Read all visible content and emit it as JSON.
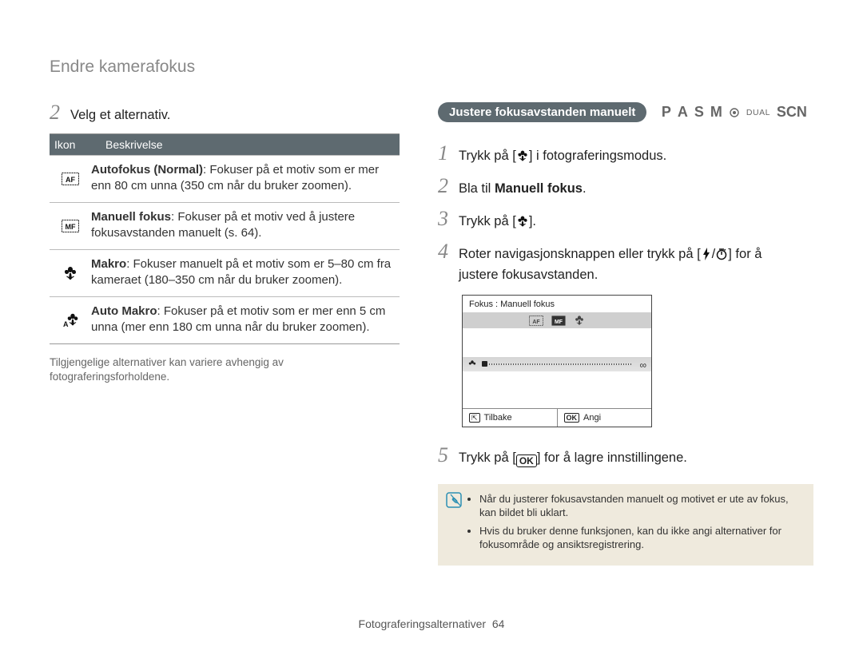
{
  "page": {
    "title": "Endre kamerafokus",
    "footer_label": "Fotograferingsalternativer",
    "footer_page": "64"
  },
  "left": {
    "step2_num": "2",
    "step2_txt": "Velg et alternativ.",
    "table": {
      "h_icon": "Ikon",
      "h_desc": "Beskrivelse",
      "rows": [
        {
          "icon_name": "af-icon",
          "desc_bold": "Autofokus (Normal)",
          "desc_rest": ": Fokuser på et motiv som er mer enn 80 cm unna (350 cm når du bruker zoomen)."
        },
        {
          "icon_name": "mf-icon",
          "desc_bold": "Manuell fokus",
          "desc_rest": ": Fokuser på et motiv ved å justere fokusavstanden manuelt (s. 64)."
        },
        {
          "icon_name": "macro-icon",
          "desc_bold": "Makro",
          "desc_rest": ": Fokuser manuelt på et motiv som er 5–80 cm fra kameraet (180–350 cm når du bruker zoomen)."
        },
        {
          "icon_name": "auto-macro-icon",
          "desc_bold": "Auto Makro",
          "desc_rest": ": Fokuser på et motiv som er mer enn 5 cm unna (mer enn 180 cm unna når du bruker zoomen)."
        }
      ]
    },
    "footnote": "Tilgjengelige alternativer kan variere avhengig av fotograferingsforholdene."
  },
  "right": {
    "pill": "Justere fokusavstanden manuelt",
    "modes": {
      "p": "P",
      "a": "A",
      "s": "S",
      "m": "M",
      "dual": "DUAL",
      "scn": "SCN"
    },
    "steps": {
      "s1_num": "1",
      "s1_a": "Trykk på [",
      "s1_b": "] i fotograferingsmodus.",
      "s2_num": "2",
      "s2_a": "Bla til ",
      "s2_bold": "Manuell fokus",
      "s2_b": ".",
      "s3_num": "3",
      "s3_a": "Trykk på [",
      "s3_b": "].",
      "s4_num": "4",
      "s4_a": "Roter navigasjonsknappen eller trykk på [",
      "s4_b": "/",
      "s4_c": "] for å justere fokusavstanden.",
      "s5_num": "5",
      "s5_a": "Trykk på [",
      "s5_b": "] for å lagre innstillingene."
    },
    "screen": {
      "title": "Fokus : Manuell fokus",
      "infinity": "∞",
      "b_left": "Tilbake",
      "b_right": "Angi",
      "ok_label": "OK"
    },
    "notes": [
      "Når du justerer fokusavstanden manuelt og motivet er ute av fokus, kan bildet bli uklart.",
      "Hvis du bruker denne funksjonen, kan du ikke angi alternativer for fokusområde og ansiktsregistrering."
    ]
  }
}
